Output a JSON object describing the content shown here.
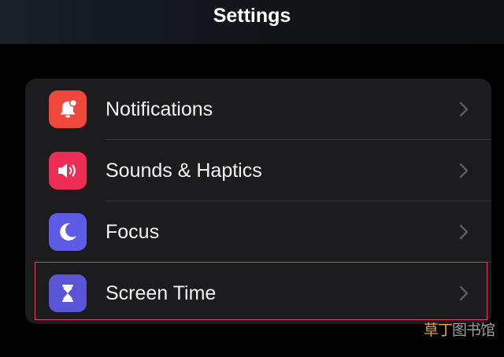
{
  "nav": {
    "title": "Settings"
  },
  "rows": [
    {
      "label": "Notifications",
      "icon": "bell-badge-icon",
      "color": "#f0473c"
    },
    {
      "label": "Sounds & Haptics",
      "icon": "speaker-icon",
      "color": "#ee2d55"
    },
    {
      "label": "Focus",
      "icon": "moon-icon",
      "color": "#5e5ce6"
    },
    {
      "label": "Screen Time",
      "icon": "hourglass-icon",
      "color": "#5a54d6"
    }
  ],
  "highlight_color": "#d83f5a",
  "watermark": {
    "part1": "草丁",
    "part2": "图书馆"
  }
}
